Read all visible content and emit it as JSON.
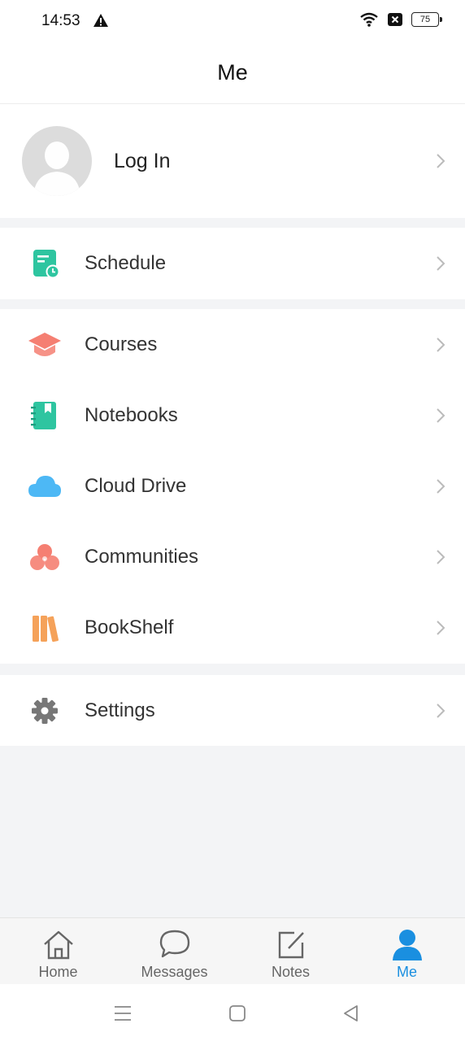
{
  "status_bar": {
    "time": "14:53",
    "battery": "75",
    "icons": [
      "warning-icon",
      "wifi-icon",
      "sim-blocked-icon",
      "battery-icon"
    ]
  },
  "header": {
    "title": "Me"
  },
  "login": {
    "label": "Log In",
    "avatar_icon": "avatar-placeholder-icon"
  },
  "menu": {
    "schedule": {
      "label": "Schedule",
      "icon": "schedule-icon",
      "color": "#2ec5a0"
    },
    "courses": {
      "label": "Courses",
      "icon": "graduation-cap-icon",
      "color": "#f57f72"
    },
    "notebooks": {
      "label": "Notebooks",
      "icon": "notebook-icon",
      "color": "#2ec5a0"
    },
    "cloud_drive": {
      "label": "Cloud Drive",
      "icon": "cloud-icon",
      "color": "#4db8f5"
    },
    "communities": {
      "label": "Communities",
      "icon": "communities-icon",
      "color": "#f57f72"
    },
    "bookshelf": {
      "label": "BookShelf",
      "icon": "books-icon",
      "color": "#f5a25a"
    },
    "settings": {
      "label": "Settings",
      "icon": "gear-icon",
      "color": "#777777"
    }
  },
  "tabs": {
    "home": {
      "label": "Home",
      "icon": "home-icon"
    },
    "messages": {
      "label": "Messages",
      "icon": "chat-bubble-icon"
    },
    "notes": {
      "label": "Notes",
      "icon": "edit-note-icon"
    },
    "me": {
      "label": "Me",
      "icon": "person-icon",
      "active": true,
      "color": "#1a8fe0"
    }
  },
  "system_nav": {
    "icons": [
      "menu-icon",
      "home-square-icon",
      "back-icon"
    ]
  }
}
